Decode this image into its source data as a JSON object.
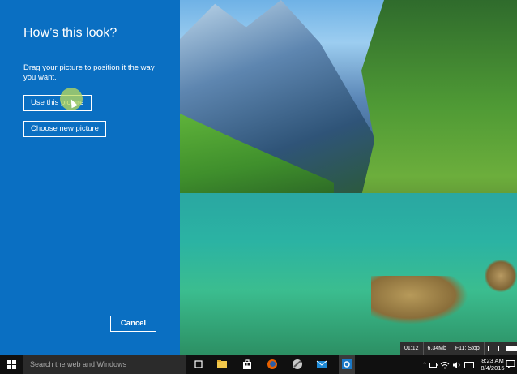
{
  "dialog": {
    "title": "How’s this look?",
    "instruction": "Drag your picture to position it the way you want.",
    "use_button": "Use this picture",
    "choose_button": "Choose new picture",
    "cancel_button": "Cancel"
  },
  "recorder": {
    "elapsed": "01:12",
    "size": "6.34Mb",
    "stop_hint": "F11: Stop"
  },
  "taskbar": {
    "search_placeholder": "Search the web and Windows",
    "time": "8:23 AM",
    "date": "8/4/2015",
    "icons": [
      "task-view-icon",
      "file-explorer-icon",
      "store-icon",
      "firefox-icon",
      "app-icon",
      "mail-icon",
      "settings-icon"
    ]
  },
  "colors": {
    "accent": "#0a6fc2",
    "taskbar": "#101010"
  }
}
